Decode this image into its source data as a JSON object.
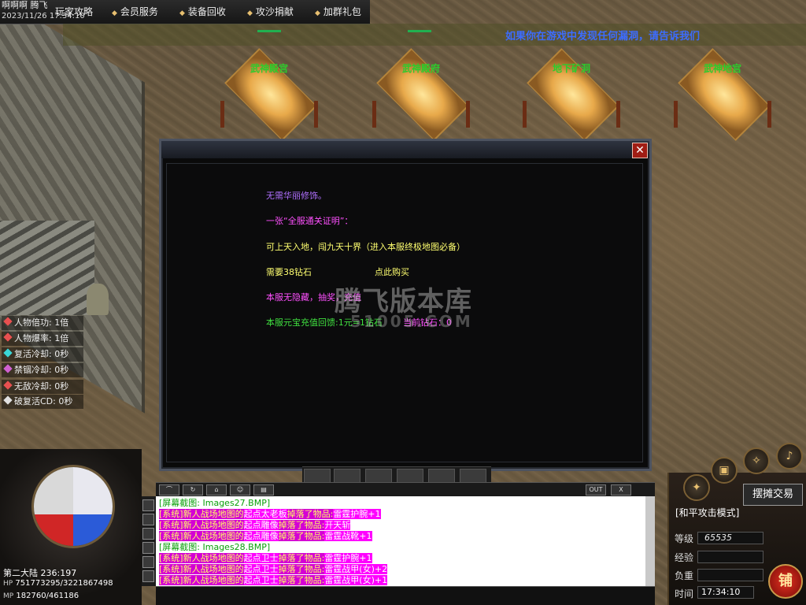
{
  "topbar": {
    "player_name": "啊啊啊 腾飞",
    "timestamp": "2023/11/26 17:34:10",
    "menu": [
      "玩家攻略",
      "会员服务",
      "装备回收",
      "攻沙捐献",
      "加群礼包"
    ]
  },
  "notice": "如果你在游戏中发现任何漏洞，请告诉我们",
  "portals": [
    "武神殿宫",
    "武神殿府",
    "地下矿洞",
    "武神地宫"
  ],
  "status_list": [
    {
      "label": "人物倍功:",
      "value": "1倍",
      "color": "#e85050"
    },
    {
      "label": "人物爆率:",
      "value": "1倍",
      "color": "#e85050"
    },
    {
      "label": "复活冷却:",
      "value": "0秒",
      "color": "#3ad6d6"
    },
    {
      "label": "禁锢冷却:",
      "value": "0秒",
      "color": "#d060d0"
    },
    {
      "label": "无敌冷却:",
      "value": "0秒",
      "color": "#e85050"
    },
    {
      "label": "破复活CD:",
      "value": "0秒",
      "color": "#e0e0e0"
    }
  ],
  "dialog": {
    "close_glyph": "✕",
    "lines": [
      {
        "text": "无需华丽修饰。",
        "color": "#b070ff"
      },
      {
        "text": "一张“全服通关证明”：",
        "color": "#ff50ff"
      },
      {
        "text": "可上天入地，闯九天十界（进入本服终极地图必备）",
        "color": "#ffff70"
      },
      {
        "text": "需要38钻石",
        "color": "#ffff70"
      },
      {
        "text": "本服无隐藏，抽奖，充值",
        "color": "#ff50ff"
      },
      {
        "text": "本服元宝充值回馈:1元=1钻石",
        "color": "#40e040"
      }
    ],
    "buy_link": "点此购买",
    "balance": "当前钻石：0",
    "watermark": "腾飞版本库",
    "watermark_sub": "51005.COM"
  },
  "chat": {
    "buttons": [
      "OUT",
      "X"
    ],
    "messages": [
      {
        "type": "shot",
        "parts": [
          "[屏幕截图: Images27.BMP]"
        ]
      },
      {
        "type": "sys",
        "parts": [
          "[系统]新人战场地图的",
          "起点太老板",
          "掉落了物品:",
          "雷霆护腕+1"
        ]
      },
      {
        "type": "sys",
        "parts": [
          "[系统]新人战场地图的",
          "起点雕像",
          "掉落了物品:",
          "开天斩"
        ]
      },
      {
        "type": "sys",
        "parts": [
          "[系统]新人战场地图的",
          "起点雕像",
          "掉落了物品:",
          "雷霆战靴+1"
        ]
      },
      {
        "type": "shot",
        "parts": [
          "[屏幕截图: Images28.BMP]"
        ]
      },
      {
        "type": "sys",
        "parts": [
          "[系统]新人战场地图的",
          "起点卫士",
          "掉落了物品:",
          "雷霆护腕+1"
        ]
      },
      {
        "type": "sys",
        "parts": [
          "[系统]新人战场地图的",
          "起点卫士",
          "掉落了物品:",
          "雷霆战甲(女)+2"
        ]
      },
      {
        "type": "sys",
        "parts": [
          "[系统]新人战场地图的",
          "起点卫士",
          "掉落了物品:",
          "雷霆战甲(女)+1"
        ]
      }
    ]
  },
  "player": {
    "map": "第二大陆",
    "coords": "236:197",
    "hp_label": "HP",
    "hp": "751773295/3221867498",
    "mp_label": "MP",
    "mp": "182760/461186"
  },
  "right_panel": {
    "trade_button": "摆摊交易",
    "mode": "[和平攻击模式]",
    "level_label": "等级",
    "level_value": "65535",
    "exp_label": "经验",
    "weight_label": "负重",
    "time_label": "时间",
    "time_value": "17:34:10",
    "shop_button": "铺"
  }
}
